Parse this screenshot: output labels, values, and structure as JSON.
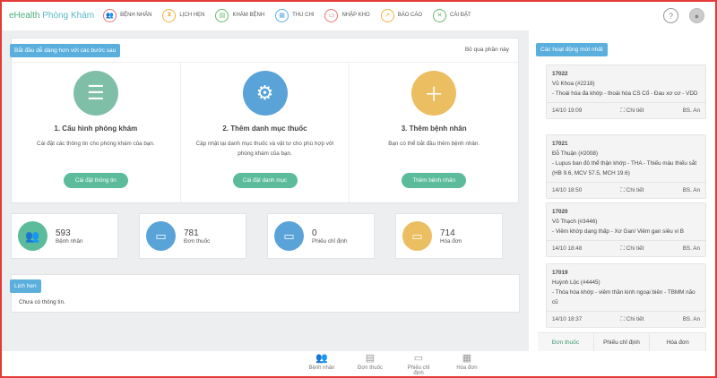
{
  "brand": {
    "part1": "eHealth",
    "part2": "Phòng Khám"
  },
  "nav": [
    {
      "label": "BỆNH NHÂN",
      "icon": "users-icon",
      "color": "#e57373",
      "glyph": "👥"
    },
    {
      "label": "LỊCH HẸN",
      "icon": "hourglass-icon",
      "color": "#f5b041",
      "glyph": "⧗"
    },
    {
      "label": "KHÁM BỆNH",
      "icon": "clipboard-icon",
      "color": "#66bb6a",
      "glyph": "▤"
    },
    {
      "label": "THU CHI",
      "icon": "calculator-icon",
      "color": "#5dade2",
      "glyph": "▦"
    },
    {
      "label": "NHẬP KHO",
      "icon": "window-icon",
      "color": "#e57373",
      "glyph": "▭"
    },
    {
      "label": "BÁO CÁO",
      "icon": "chart-icon",
      "color": "#f5b041",
      "glyph": "↗"
    },
    {
      "label": "CÀI ĐẶT",
      "icon": "tools-icon",
      "color": "#66bb6a",
      "glyph": "✕"
    }
  ],
  "setup": {
    "title": "Bắt đầu dễ dàng hơn với các bước sau",
    "skip": "Bỏ qua phần này",
    "steps": [
      {
        "title": "1. Cấu hình phòng khám",
        "desc": "Cài đặt các thông tin cho phòng khám của bạn.",
        "button": "Cài đặt thông tin",
        "color": "#7fbfa7",
        "glyph": "☰"
      },
      {
        "title": "2. Thêm danh mục thuốc",
        "desc": "Cập nhật lại danh mục thuốc và vật tư cho phù hợp với phòng khám của bạn.",
        "button": "Cài đặt danh mục",
        "color": "#5aa3d8",
        "glyph": "⚙"
      },
      {
        "title": "3. Thêm bệnh nhân",
        "desc": "Bạn có thể bắt đầu thêm bệnh nhân.",
        "button": "Thêm bệnh nhân",
        "color": "#ecbe62",
        "glyph": "＋"
      }
    ]
  },
  "stats": [
    {
      "value": "593",
      "label": "Bệnh nhân",
      "color": "#5bbb9b"
    },
    {
      "value": "781",
      "label": "Đơn thuốc",
      "color": "#5aa3d8"
    },
    {
      "value": "0",
      "label": "Phiếu chỉ định",
      "color": "#5aa3d8"
    },
    {
      "value": "714",
      "label": "Hóa đơn",
      "color": "#ecbe62"
    }
  ],
  "appointments": {
    "title": "Lịch hẹn",
    "empty": "Chưa có thông tin."
  },
  "activity": {
    "title": "Các hoạt động mới nhất",
    "detail": "Chi tiết",
    "items": [
      {
        "id": "17022",
        "patient": "Vũ Khoa (#2218)",
        "diag": "- Thoái hóa đa khớp - thoái hóa CS Cổ - Đau xơ cơ - VDD",
        "time": "14/10 19:09",
        "doctor": "BS. An"
      },
      {
        "id": "17021",
        "patient": "Đỗ Thuận (#2008)",
        "diag": "- Lupus ban đỏ thể thận khớp - THA - Thiếu máu thiếu sắt (HB 9.6, MCV 57.5, MCH 19.6)",
        "time": "14/10 18:50",
        "doctor": "BS. An"
      },
      {
        "id": "17020",
        "patient": "Võ Thạch (#3446)",
        "diag": "- Viêm khớp dạng thấp - Xơ Gan/ Viêm gan siêu vi B",
        "time": "14/10 18:48",
        "doctor": "BS. An"
      },
      {
        "id": "17019",
        "patient": "Huỳnh Lộc (#4445)",
        "diag": "- Thóa hóa khớp - viêm thần kinh ngoại biên - TBMM não cũ",
        "time": "14/10 18:37",
        "doctor": "BS. An"
      }
    ],
    "tabs": [
      "Đơn thuốc",
      "Phiếu chỉ định",
      "Hóa đơn"
    ]
  },
  "footer": [
    {
      "label": "Bệnh nhân",
      "icon": "users-icon",
      "glyph": "👥"
    },
    {
      "label": "Đơn thuốc",
      "icon": "clipboard-icon",
      "glyph": "▤"
    },
    {
      "label": "Phiếu chỉ định",
      "icon": "window-icon",
      "glyph": "▭"
    },
    {
      "label": "Hóa đơn",
      "icon": "receipt-icon",
      "glyph": "▦"
    }
  ]
}
